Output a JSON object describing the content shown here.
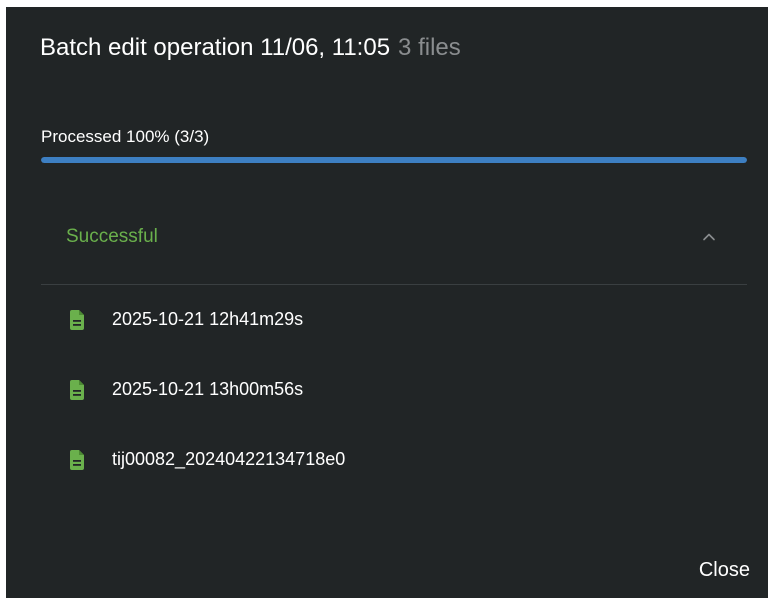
{
  "dialog": {
    "title": "Batch edit operation 11/06, 11:05",
    "file_count": "3 files",
    "close_label": "Close"
  },
  "progress": {
    "label": "Processed 100% (3/3)",
    "fraction": 1.0,
    "color": "#3d7fc2"
  },
  "section": {
    "title": "Successful",
    "title_color": "#6ab04c",
    "expanded": true,
    "icon": "chevron-up-icon"
  },
  "files": [
    {
      "name": "2025-10-21 12h41m29s",
      "icon": "file-document-icon"
    },
    {
      "name": "2025-10-21 13h00m56s",
      "icon": "file-document-icon"
    },
    {
      "name": "tij00082_20240422134718e0",
      "icon": "file-document-icon"
    }
  ]
}
